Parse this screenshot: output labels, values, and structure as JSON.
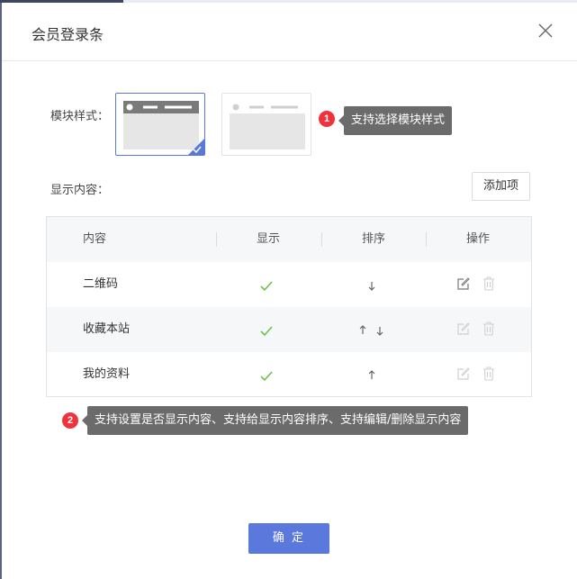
{
  "dialog": {
    "title": "会员登录条"
  },
  "module_style": {
    "label": "模块样式：",
    "options": [
      {
        "name": "style-1",
        "selected": true
      },
      {
        "name": "style-2",
        "selected": false
      }
    ]
  },
  "annotations": [
    {
      "number": "1",
      "text": "支持选择模块样式"
    },
    {
      "number": "2",
      "text": "支持设置是否显示内容、支持给显示内容排序、支持编辑/删除显示内容"
    }
  ],
  "content": {
    "label": "显示内容：",
    "add_button": "添加项"
  },
  "table": {
    "headers": [
      "内容",
      "显示",
      "排序",
      "操作"
    ],
    "rows": [
      {
        "name": "二维码",
        "visible": true,
        "sort": [
          "down"
        ],
        "edit_enabled": true,
        "delete_enabled": false
      },
      {
        "name": "收藏本站",
        "visible": true,
        "sort": [
          "up",
          "down"
        ],
        "edit_enabled": false,
        "delete_enabled": false
      },
      {
        "name": "我的资料",
        "visible": true,
        "sort": [
          "up"
        ],
        "edit_enabled": false,
        "delete_enabled": false
      }
    ]
  },
  "footer": {
    "confirm": "确 定"
  },
  "colors": {
    "accent": "#5b78dc",
    "badge": "#f0333b",
    "check": "#6cc24a",
    "tooltip": "#6b6b6b"
  }
}
